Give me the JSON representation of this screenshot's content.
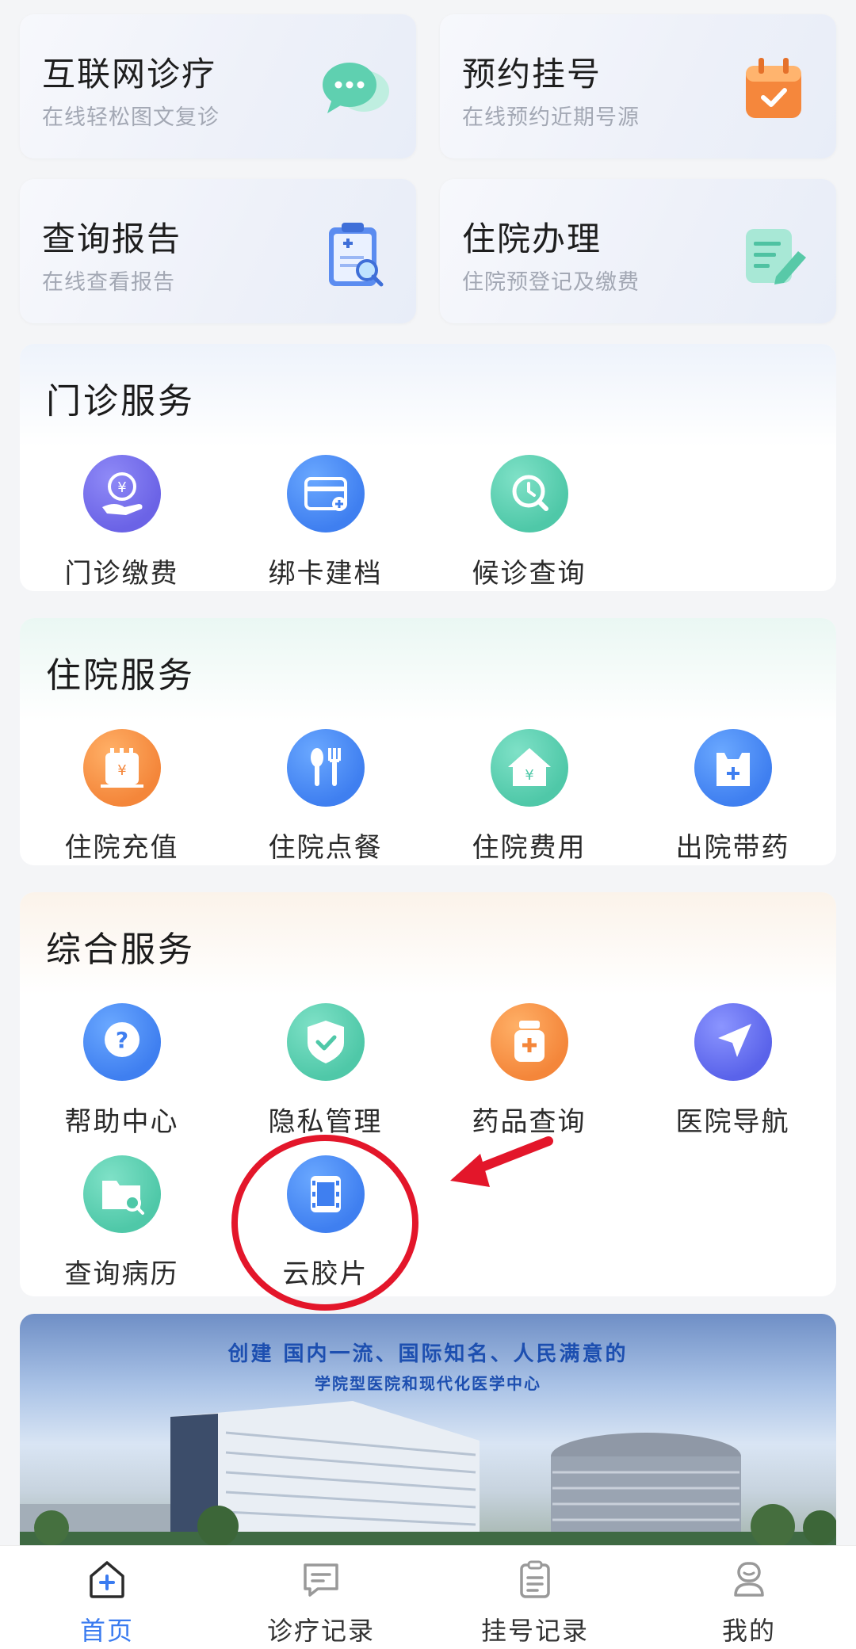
{
  "quick_cards": [
    {
      "title": "互联网诊疗",
      "subtitle": "在线轻松图文复诊",
      "icon": "chat-bubble-icon"
    },
    {
      "title": "预约挂号",
      "subtitle": "在线预约近期号源",
      "icon": "calendar-icon"
    },
    {
      "title": "查询报告",
      "subtitle": "在线查看报告",
      "icon": "report-search-icon"
    },
    {
      "title": "住院办理",
      "subtitle": "住院预登记及缴费",
      "icon": "form-edit-icon"
    }
  ],
  "sections": {
    "outpatient": {
      "title": "门诊服务",
      "items": [
        {
          "label": "门诊缴费",
          "icon": "payment-hand-icon"
        },
        {
          "label": "绑卡建档",
          "icon": "card-icon"
        },
        {
          "label": "候诊查询",
          "icon": "queue-search-icon"
        }
      ]
    },
    "inpatient": {
      "title": "住院服务",
      "items": [
        {
          "label": "住院充值",
          "icon": "recharge-icon"
        },
        {
          "label": "住院点餐",
          "icon": "fork-spoon-icon"
        },
        {
          "label": "住院费用",
          "icon": "home-fee-icon"
        },
        {
          "label": "出院带药",
          "icon": "medicine-bag-icon"
        }
      ]
    },
    "general": {
      "title": "综合服务",
      "items": [
        {
          "label": "帮助中心",
          "icon": "help-icon"
        },
        {
          "label": "隐私管理",
          "icon": "shield-check-icon"
        },
        {
          "label": "药品查询",
          "icon": "medicine-bottle-icon"
        },
        {
          "label": "医院导航",
          "icon": "navigation-arrow-icon"
        },
        {
          "label": "查询病历",
          "icon": "folder-search-icon"
        },
        {
          "label": "云胶片",
          "icon": "film-icon"
        }
      ]
    }
  },
  "banner": {
    "line1": "创建 国内一流、国际知名、人民满意的",
    "line2": "学院型医院和现代化医学中心"
  },
  "tabbar": {
    "tabs": [
      {
        "label": "首页",
        "icon": "home-plus-icon",
        "active": true
      },
      {
        "label": "诊疗记录",
        "icon": "message-icon",
        "active": false
      },
      {
        "label": "挂号记录",
        "icon": "clipboard-icon",
        "active": false
      },
      {
        "label": "我的",
        "icon": "profile-icon",
        "active": false
      }
    ]
  },
  "colors": {
    "accent": "#3a7bf0",
    "annotation": "#e3162a"
  }
}
